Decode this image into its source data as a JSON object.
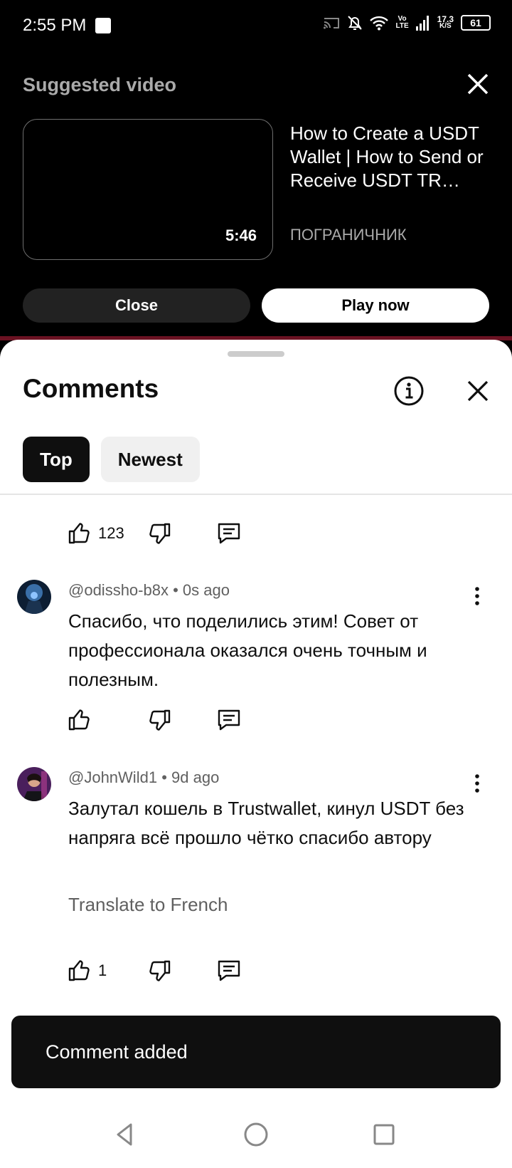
{
  "status_bar": {
    "time": "2:55 PM",
    "network_top": "Vo",
    "network_bottom": "LTE",
    "speed_top": "17.3",
    "speed_bottom": "K/S",
    "battery": "61"
  },
  "suggested": {
    "header": "Suggested video",
    "video_title": "How to Create a USDT Wallet | How to Send or Receive USDT TR…",
    "channel": "ПОГРАНИЧНИК",
    "duration": "5:46",
    "close_label": "Close",
    "play_label": "Play now"
  },
  "comments": {
    "title": "Comments",
    "chips": [
      "Top",
      "Newest"
    ],
    "first_actions": {
      "like_count": "123"
    },
    "items": [
      {
        "author": "@odissho-b8x",
        "time": "0s ago",
        "text": "Спасибо, что поделились этим! Совет от профессионала оказался очень точным и полезным."
      },
      {
        "author": "@JohnWild1",
        "time": "9d ago",
        "text": "Залутал кошель в Trustwallet, кинул USDT без напряга всё прошло чётко спасибо автору",
        "translate": "Translate to French",
        "like_count": "1"
      }
    ]
  },
  "snackbar": {
    "message": "Comment added"
  },
  "colors": {
    "accent_line": "#6b1222",
    "battery_fill": "#ffffff",
    "sheet_bg": "#ffffff",
    "text_primary": "#0f0f0f",
    "text_secondary": "#606060"
  }
}
